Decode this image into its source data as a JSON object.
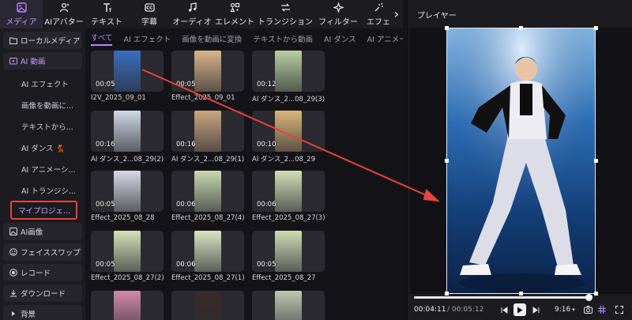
{
  "toolbar": {
    "items": [
      {
        "label": "メディア",
        "icon": "media-icon",
        "active": true
      },
      {
        "label": "AIアバター",
        "icon": "avatar-icon"
      },
      {
        "label": "テキスト",
        "icon": "text-icon"
      },
      {
        "label": "字幕",
        "icon": "subtitle-icon"
      },
      {
        "label": "オーディオ",
        "icon": "audio-icon"
      },
      {
        "label": "エレメント",
        "icon": "element-icon"
      },
      {
        "label": "トランジション",
        "icon": "transition-icon"
      },
      {
        "label": "フィルター",
        "icon": "filter-icon"
      },
      {
        "label": "エフェ",
        "icon": "effect-icon"
      }
    ],
    "accent": "#b784ff"
  },
  "sidebar": {
    "local_media": "ローカルメディア",
    "ai_video": "AI 動画",
    "subs": [
      "AI エフェクト",
      "画像を動画に...",
      "テキストから...",
      "AI ダンス 💃",
      "AI アニメーシ...",
      "AI トランジシ...",
      "マイプロジェ..."
    ],
    "ai_image": "AI画像",
    "face_swap": "フェイススワップ",
    "record": "レコード",
    "download": "ダウンロード",
    "background": "背景"
  },
  "tabs": [
    "すべて",
    "AI エフェクト",
    "画像を動画に変換",
    "テキストから動画",
    "AI ダンス",
    "AI アニメーシ"
  ],
  "grid": [
    {
      "dur": "00:05",
      "name": "I2V_2025_09_01",
      "tone": "#3a6fbf"
    },
    {
      "dur": "00:05",
      "name": "Effect_2025_09_01",
      "tone": "#d9b48a"
    },
    {
      "dur": "00:12",
      "name": "AI ダンス_2...08_29(3)",
      "tone": "#b9cfa0"
    },
    {
      "dur": "00:16",
      "name": "AI ダンス_2...08_29(2)",
      "tone": "#cfd9e6"
    },
    {
      "dur": "00:16",
      "name": "AI ダンス_2...08_29(1)",
      "tone": "#c9a680"
    },
    {
      "dur": "00:10",
      "name": "AI ダンス_2...08_29",
      "tone": "#d9b67a"
    },
    {
      "dur": "00:05",
      "name": "Effect_2025_08_28",
      "tone": "#d8d8e6"
    },
    {
      "dur": "00:06",
      "name": "Effect_2025_08_27(4)",
      "tone": "#c9d9b0"
    },
    {
      "dur": "00:06",
      "name": "Effect_2025_08_27(3)",
      "tone": "#d2deb8"
    },
    {
      "dur": "00:05",
      "name": "Effect_2025_08_27(2)",
      "tone": "#d6e0b8"
    },
    {
      "dur": "00:06",
      "name": "Effect_2025_08_27(1)",
      "tone": "#dae4c0"
    },
    {
      "dur": "00:05",
      "name": "Effect_2025_08_27",
      "tone": "#d0dcb4"
    },
    {
      "dur": "",
      "name": "",
      "tone": "#d08aa8"
    },
    {
      "dur": "",
      "name": "",
      "tone": "#3a2a2a"
    },
    {
      "dur": "",
      "name": "",
      "tone": "#c0c8b0"
    }
  ],
  "player": {
    "title": "プレイヤー",
    "time_current": "00:04:11",
    "time_total": "/ 00:05:12",
    "ratio": "9:16",
    "progress": 1.0
  }
}
